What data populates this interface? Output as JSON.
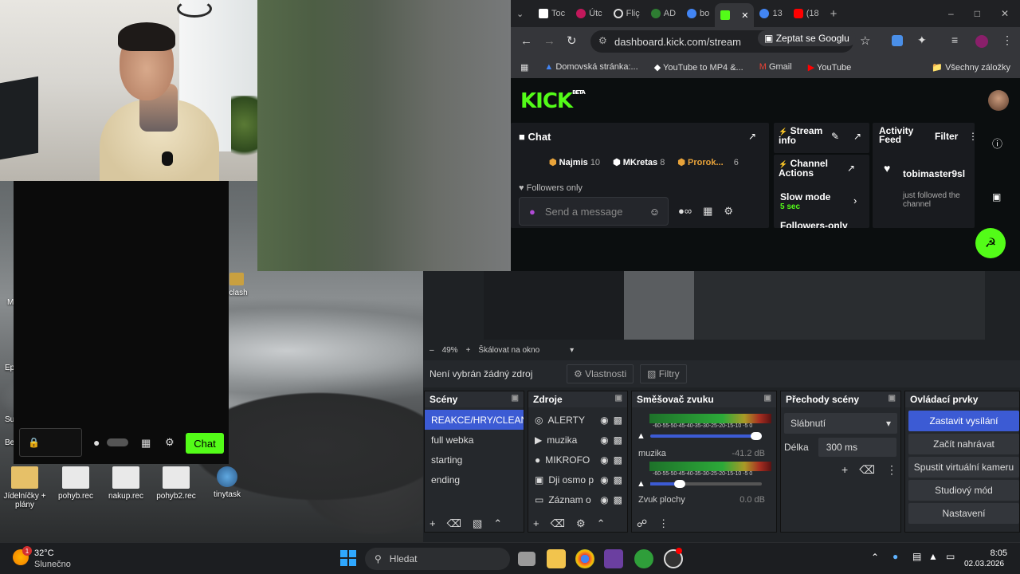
{
  "desktop": {
    "icons": [
      {
        "label": "Jídelníčky + plány"
      },
      {
        "label": "pohyb.rec"
      },
      {
        "label": "nakup.rec"
      },
      {
        "label": "pohyb2.rec"
      },
      {
        "label": "tinytask"
      },
      {
        "label": "clash"
      }
    ],
    "partial_labels": [
      "Ep",
      "Su",
      "Be",
      "M"
    ]
  },
  "overlay_chat": {
    "chat_button": "Chat"
  },
  "browser": {
    "tabs": [
      {
        "label": "Toc",
        "color": "#ffffff"
      },
      {
        "label": "Útc",
        "color": "#c2185b"
      },
      {
        "label": "Fliç",
        "color": "#dddddd"
      },
      {
        "label": "AD",
        "color": "#2e7d32"
      },
      {
        "label": "bo",
        "color": "#4285f4"
      },
      {
        "label": "",
        "color": "#53fc18",
        "active": true
      },
      {
        "label": "13",
        "color": "#4285f4"
      },
      {
        "label": "(18",
        "color": "#ff0000"
      }
    ],
    "url": "dashboard.kick.com/stream",
    "ask_google": "Zeptat se Googlu",
    "bookmarks": [
      {
        "label": "Domovská stránka:..."
      },
      {
        "label": "YouTube to MP4 &..."
      },
      {
        "label": "Gmail"
      },
      {
        "label": "YouTube"
      }
    ],
    "all_bookmarks": "Všechny záložky"
  },
  "kick": {
    "logo": "KICK",
    "beta": "BETA",
    "chat": {
      "title": "Chat",
      "leaders": [
        {
          "name": "Najmis",
          "count": "10",
          "color": "#e8a33a"
        },
        {
          "name": "MKretas",
          "count": "8",
          "color": "#ffffff"
        },
        {
          "name": "Prorok...",
          "count": "6",
          "color": "#e8a33a"
        }
      ],
      "followers_only": "Followers only",
      "placeholder": "Send a message"
    },
    "stream_info": {
      "title": "Stream info"
    },
    "channel_actions": {
      "title": "Channel Actions",
      "slow_mode": "Slow mode",
      "slow_value": "5 sec",
      "followers_only": "Followers-only"
    },
    "activity": {
      "title": "Activity Feed",
      "filter": "Filter",
      "user": "tobimaster9sl",
      "event": "just followed the channel"
    }
  },
  "obs": {
    "zoom": "49%",
    "scale_mode": "Škálovat na okno",
    "no_source": "Není vybrán žádný zdroj",
    "properties": "Vlastnosti",
    "filters": "Filtry",
    "scenes": {
      "title": "Scény",
      "items": [
        "REAKCE/HRY/CLEANFEED",
        "full webka",
        "starting",
        "ending"
      ]
    },
    "sources": {
      "title": "Zdroje",
      "items": [
        "ALERTY",
        "muzika",
        "MIKROFO",
        "Dji osmo p",
        "Záznam o"
      ]
    },
    "mixer": {
      "title": "Směšovač zvuku",
      "scale": "-60-55-50-45-40-35-30-25-20-15-10 -5  0",
      "channels": [
        {
          "name": "muzika",
          "db": "-41.2 dB"
        },
        {
          "name": "Zvuk plochy",
          "db": "0.0 dB"
        }
      ]
    },
    "transitions": {
      "title": "Přechody scény",
      "type": "Slábnutí",
      "duration_label": "Délka",
      "duration": "300 ms"
    },
    "controls": {
      "title": "Ovládací prvky",
      "buttons": [
        "Zastavit vysílání",
        "Začít nahrávat",
        "Spustit virtuální kameru",
        "Studiový mód",
        "Nastavení"
      ]
    }
  },
  "taskbar": {
    "weather_temp": "32°C",
    "weather_text": "Slunečno",
    "weather_badge": "1",
    "search": "Hledat",
    "time": "8:05",
    "date": "02.03.2026"
  }
}
